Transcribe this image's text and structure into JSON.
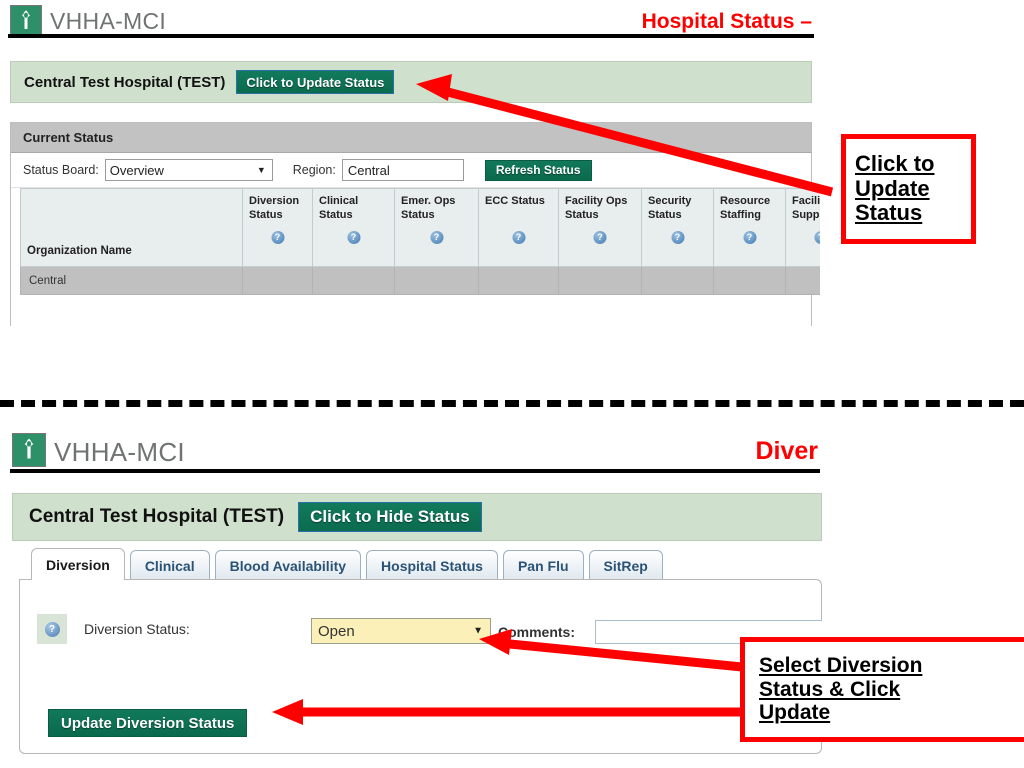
{
  "slide": {
    "divider": "dashed-horizontal-rule"
  },
  "top_section": {
    "brand": "VHHA-MCI",
    "logo_icon": "vhha-caduceus-logo",
    "page_title": "Hospital Status –",
    "facility": {
      "name": "Central Test Hospital (TEST)",
      "action_button": "Click to Update Status"
    },
    "panel": {
      "heading": "Current Status",
      "filters": {
        "status_board_label": "Status Board:",
        "status_board_value": "Overview",
        "region_label": "Region:",
        "region_value": "Central",
        "refresh_button": "Refresh Status"
      },
      "table": {
        "org_column": "Organization Name",
        "columns": [
          "Diversion Status",
          "Clinical Status",
          "Emer. Ops Status",
          "ECC Status",
          "Facility Ops Status",
          "Security Status",
          "Resource Staffing",
          "Facility Supp"
        ],
        "help_icon": "?",
        "group_row": "Central"
      }
    },
    "annotation": {
      "line1": "Click to",
      "line2": "Update",
      "line3": "Status"
    }
  },
  "bottom_section": {
    "brand": "VHHA-MCI",
    "logo_icon": "vhha-caduceus-logo",
    "page_title": "Diver",
    "facility": {
      "name": "Central Test Hospital (TEST)",
      "action_button": "Click to Hide Status"
    },
    "tabs": [
      {
        "label": "Diversion",
        "active": true
      },
      {
        "label": "Clinical",
        "active": false
      },
      {
        "label": "Blood Availability",
        "active": false
      },
      {
        "label": "Hospital Status",
        "active": false
      },
      {
        "label": "Pan Flu",
        "active": false
      },
      {
        "label": "SitRep",
        "active": false
      }
    ],
    "form": {
      "help_icon": "?",
      "diversion_status_label": "Diversion Status:",
      "diversion_status_value": "Open",
      "diversion_status_options": [
        "Open"
      ],
      "comments_label": "Comments:",
      "comments_value": "",
      "update_button": "Update Diversion Status"
    },
    "annotation": {
      "line1": "Select Diversion",
      "line2": "Status & Click",
      "line3": "Update"
    }
  },
  "colors": {
    "red_accent": "#ff0000",
    "brand_green": "#2e9069",
    "button_green": "#0b6b4e",
    "facility_band": "#cfe0cc",
    "panel_header_gray": "#c2c2c2",
    "table_header": "#e8eded",
    "group_row_gray": "#c0c0c0",
    "dropdown_yellow": "#fbf0b8"
  }
}
